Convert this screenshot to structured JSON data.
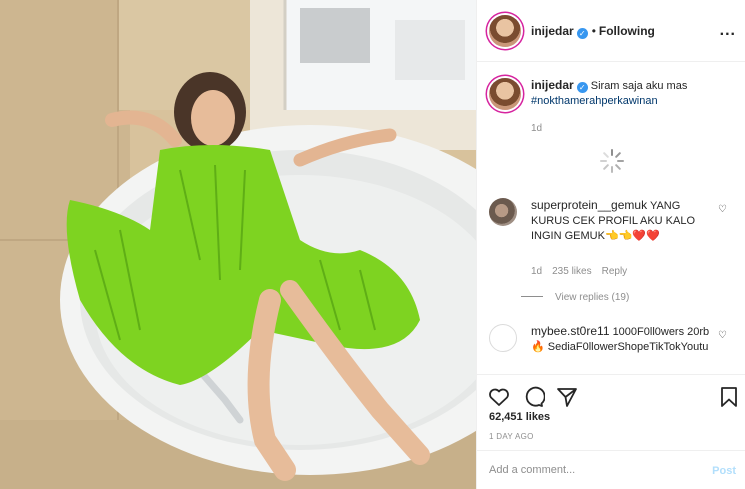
{
  "header": {
    "username": "inijedar",
    "separator": "•",
    "follow_status": "Following",
    "more": "..."
  },
  "caption": {
    "username": "inijedar",
    "text": "Siram saja aku mas",
    "hashtag": "#nokthamerahperkawinan",
    "age": "1d"
  },
  "comments": [
    {
      "username": "superprotein__gemuk",
      "text": "YANG KURUS CEK PROFIL AKU KALO INGIN GEMUK👈👈❤️❤️",
      "age": "1d",
      "likes": "235 likes",
      "reply": "Reply",
      "view_replies": "View replies (19)"
    },
    {
      "username": "mybee.st0re11",
      "text": "1000F0ll0wers 20rb🔥 SediaF0llowerShopeTikTokYoutu",
      "age": ""
    }
  ],
  "actions": {
    "likes": "62,451 likes",
    "posted": "1 DAY AGO"
  },
  "add_comment": {
    "placeholder": "Add a comment...",
    "post_label": "Post"
  },
  "icons": {
    "like": "heart-icon",
    "comment": "comment-icon",
    "share": "share-icon",
    "save": "bookmark-icon",
    "verified": "verified-badge-icon"
  },
  "colors": {
    "accent": "#3897f0",
    "post_disabled": "#b2dffc",
    "dress": "#7ed321"
  }
}
